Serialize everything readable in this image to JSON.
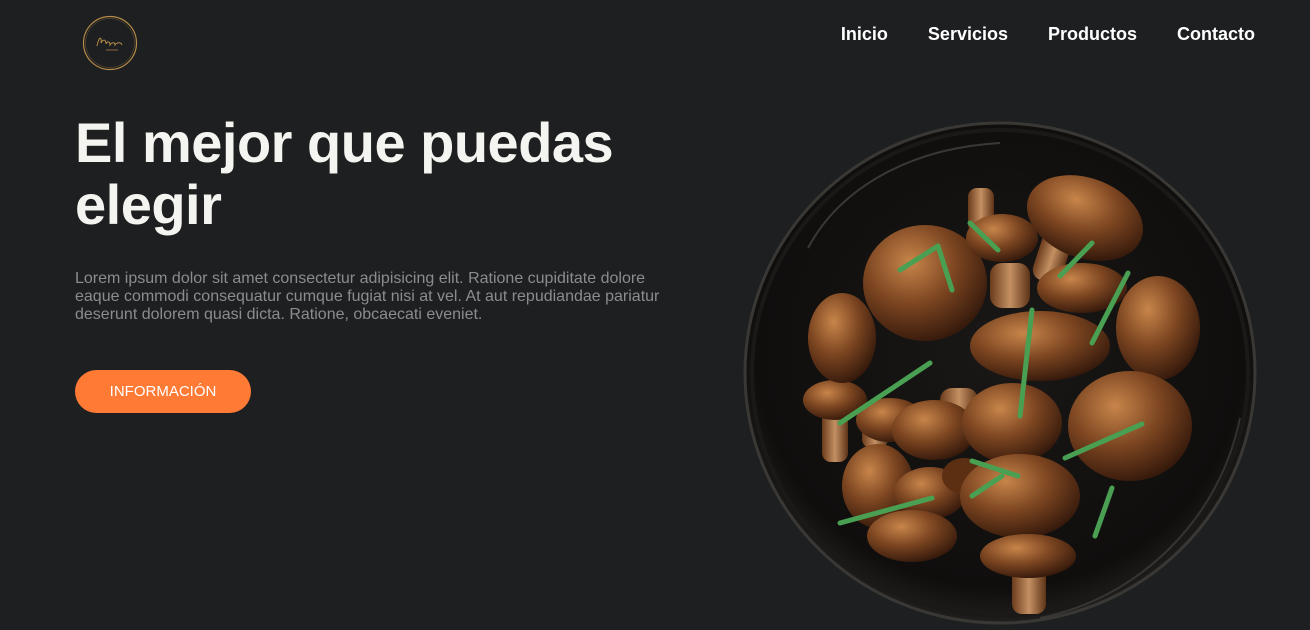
{
  "header": {
    "logo": {
      "icon": "circular-signature-logo",
      "accent_color": "#b58b48"
    },
    "nav": [
      "Inicio",
      "Servicios",
      "Productos",
      "Contacto"
    ]
  },
  "hero": {
    "title": "El mejor que puedas elegir",
    "description": "Lorem ipsum dolor sit amet consectetur adipisicing elit. Ratione cupiditate dolore eaque commodi consequatur cumque fugiat nisi at vel. At aut repudiandae pariatur deserunt dolorem quasi dicta. Ratione, obcaecati eveniet.",
    "button_label": "INFORMACIÓN",
    "button_color": "#ff7a35",
    "image": "bowl-of-roasted-mushrooms-with-rosemary"
  },
  "colors": {
    "background": "#1e1f21",
    "text": "#ffffff",
    "muted_text": "#8b8c8e"
  }
}
